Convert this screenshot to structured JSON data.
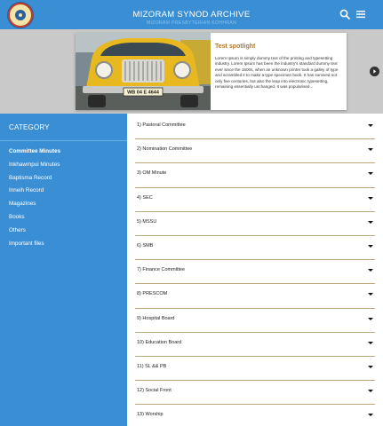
{
  "header": {
    "title": "MIZORAM SYNOD ARCHIVE",
    "subtitle": "MIZORAM PRESBYTERIAN KOHHRAN",
    "brand_color": "#3a8fd4"
  },
  "icons": {
    "search": "search-icon",
    "menu": "hamburger-menu-icon",
    "next": "chevron-right-icon",
    "expand": "caret-down-icon"
  },
  "slider": {
    "title": "Test spotlight",
    "body": "Lorem Ipsum is simply dummy text of the printing and typesetting industry. Lorem Ipsum has been the industry's standard dummy text ever since the 1500s, when an unknown printer took a galley of type and scrambled it to make a type specimen book. It has survived not only five centuries, but also the leap into electronic typesetting, remaining essentially unchanged. It was popularised...",
    "photo_plate": "WB 04 E 4644"
  },
  "sidebar": {
    "heading": "CATEGORY",
    "items": [
      {
        "label": "Committee Minutes",
        "active": true
      },
      {
        "label": "Inkhawmpui Minutes"
      },
      {
        "label": "Baptisma Record"
      },
      {
        "label": "Inneih Record"
      },
      {
        "label": "Magazines"
      },
      {
        "label": "Books"
      },
      {
        "label": "Others"
      },
      {
        "label": "Important files"
      }
    ]
  },
  "accordion": [
    {
      "label": "1) Pastoral Committee"
    },
    {
      "label": "2) Nomination Committee"
    },
    {
      "label": "3) OM Minute"
    },
    {
      "label": "4) SEC"
    },
    {
      "label": "5) MSSU"
    },
    {
      "label": "6) SMB"
    },
    {
      "label": "7) Finance Committee"
    },
    {
      "label": "8) PRESCOM"
    },
    {
      "label": "9) Hospital Board"
    },
    {
      "label": "10) Education Board"
    },
    {
      "label": "11) SL && PB"
    },
    {
      "label": "12) Social Front"
    },
    {
      "label": "13) Worship"
    }
  ]
}
